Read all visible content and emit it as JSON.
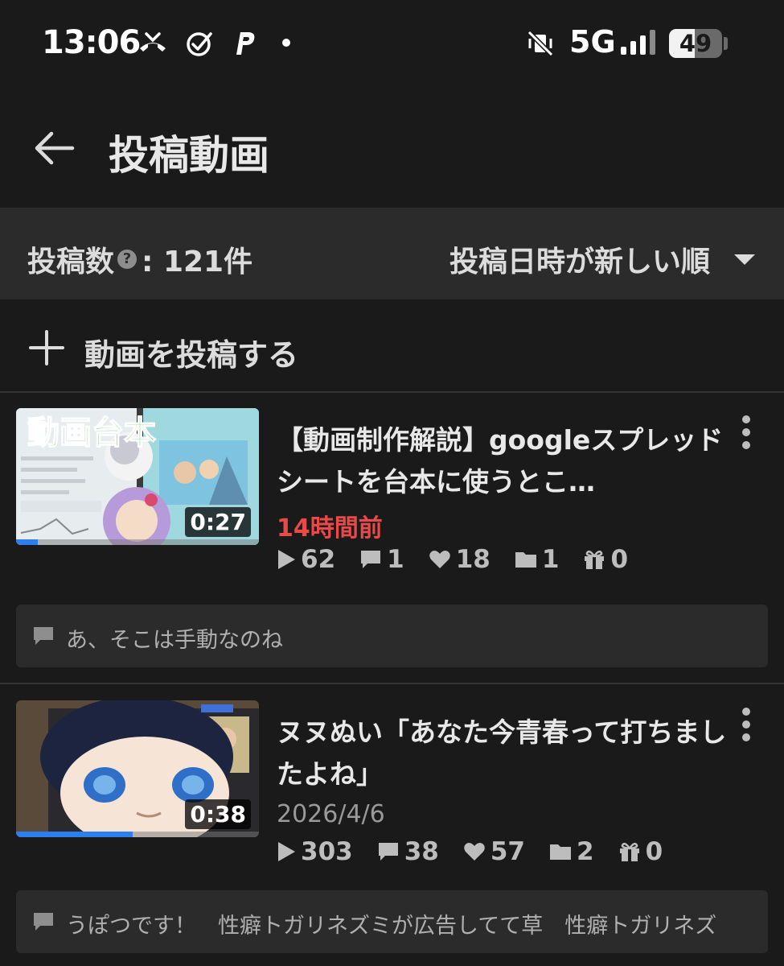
{
  "status_bar": {
    "time": "13:06",
    "network": "5G",
    "battery_level": "49",
    "battery_fraction": 0.49
  },
  "header": {
    "title": "投稿動画"
  },
  "sort_bar": {
    "count_label": "投稿数",
    "count_value": ": 121件",
    "sort_label": "投稿日時が新しい順"
  },
  "add_video": {
    "label": "動画を投稿する"
  },
  "videos": [
    {
      "title": "【動画制作解説】googleスプレッドシートを台本に使うとこ…",
      "date": "14時間前",
      "date_recent": true,
      "duration": "0:27",
      "progress": 0.09,
      "thumbnail_text": "動画台本",
      "stats": {
        "views": "62",
        "comments": "1",
        "likes": "18",
        "mylists": "1",
        "gifts": "0"
      },
      "comment_preview": "あ、そこは手動なのね"
    },
    {
      "title": "ヌヌぬい「あなた今青春って打ちましたよね」",
      "date": "2026/4/6",
      "date_recent": false,
      "duration": "0:38",
      "progress": 0.48,
      "stats": {
        "views": "303",
        "comments": "38",
        "likes": "57",
        "mylists": "2",
        "gifts": "0"
      },
      "comment_preview": "うぽつです！　性癖トガリネズミが広告してて草　性癖トガリネズ"
    }
  ],
  "colors": {
    "background": "#1a1a1a",
    "panel": "#2b2b2b",
    "recent_date": "#e84a4a",
    "progress": "#2d7ff0"
  }
}
